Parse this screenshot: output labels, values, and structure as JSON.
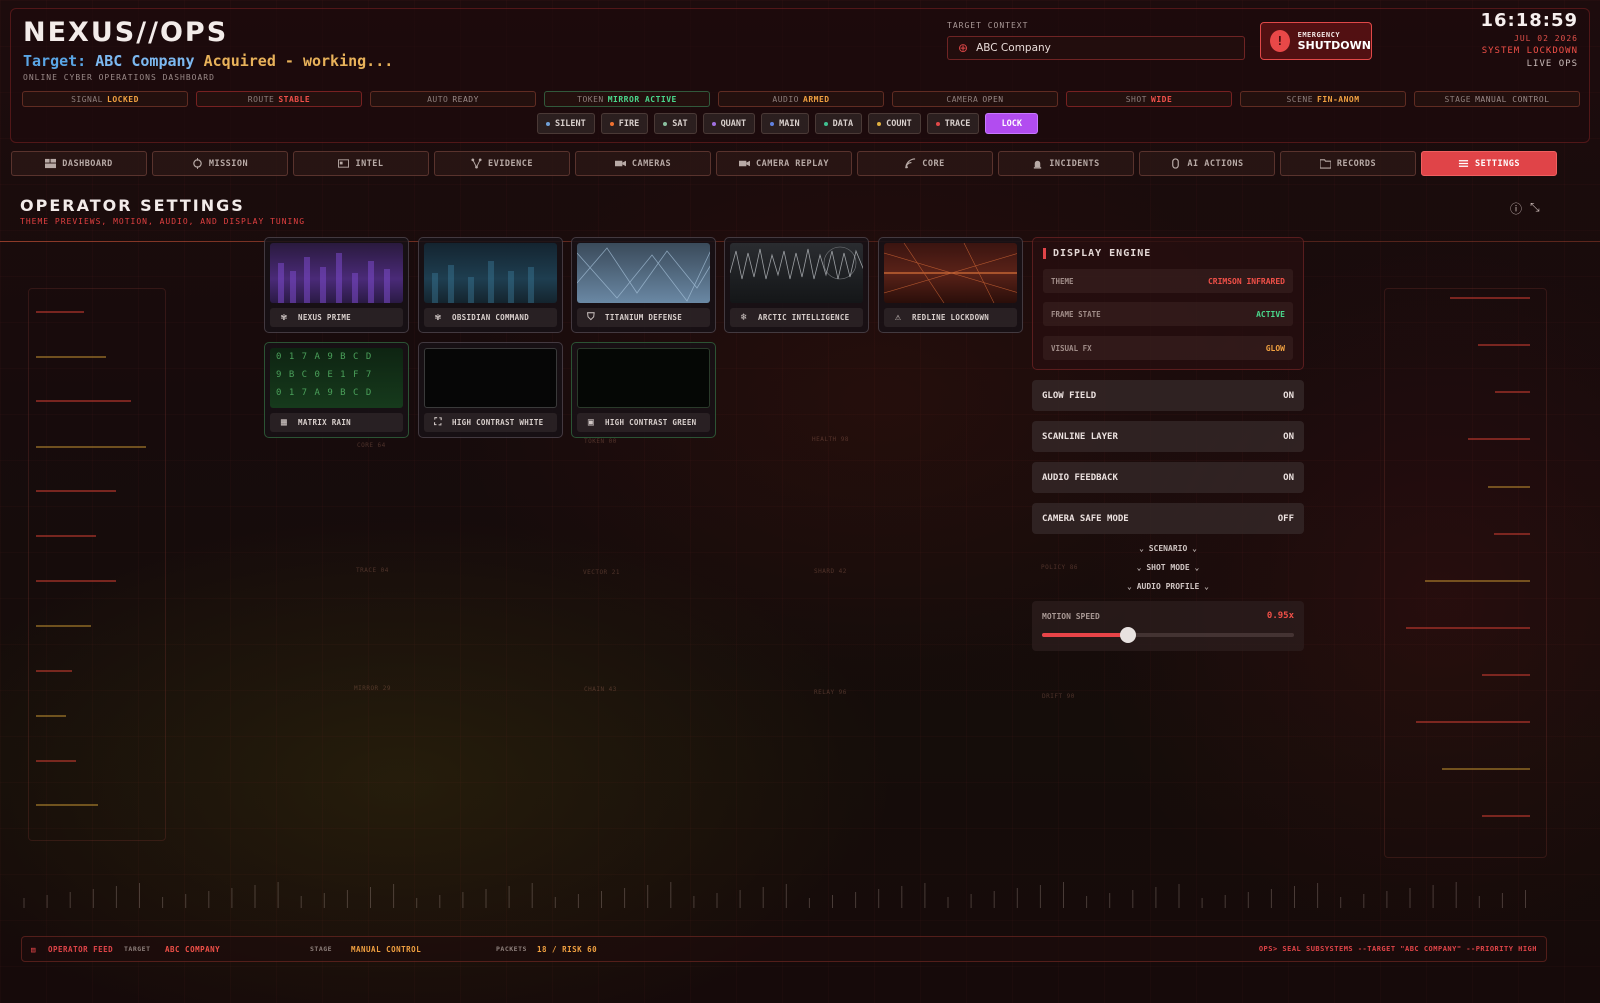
{
  "header": {
    "brand": "NEXUS//OPS",
    "target_prefix": "Target:",
    "target_name": "ABC Company",
    "target_suffix": "Acquired - working...",
    "subtitle": "ONLINE CYBER OPERATIONS DASHBOARD",
    "target_context_label": "TARGET CONTEXT",
    "target_context_value": "ABC Company",
    "emergency_line1": "EMERGENCY",
    "emergency_line2": "SHUTDOWN",
    "time": "16:18:59",
    "date": "JUL 02 2026",
    "lockdown": "SYSTEM LOCKDOWN",
    "live": "LIVE OPS"
  },
  "status_chips": [
    {
      "k": "SIGNAL",
      "v": "LOCKED",
      "tone": "orange"
    },
    {
      "k": "ROUTE",
      "v": "STABLE",
      "tone": "red"
    },
    {
      "k": "AUTO",
      "v": "READY",
      "tone": "mute"
    },
    {
      "k": "TOKEN",
      "v": "MIRROR ACTIVE",
      "tone": "green"
    },
    {
      "k": "AUDIO",
      "v": "ARMED",
      "tone": "orange"
    },
    {
      "k": "CAMERA",
      "v": "OPEN",
      "tone": "mute"
    },
    {
      "k": "SHOT",
      "v": "WIDE",
      "tone": "red"
    },
    {
      "k": "SCENE",
      "v": "FIN-ANOM",
      "tone": "orange"
    },
    {
      "k": "STAGE",
      "v": "MANUAL CONTROL",
      "tone": "mute"
    }
  ],
  "modes": [
    {
      "label": "SILENT",
      "dot": "#6fa0d8"
    },
    {
      "label": "FIRE",
      "dot": "#f07030"
    },
    {
      "label": "SAT",
      "dot": "#8ac0a0"
    },
    {
      "label": "QUANT",
      "dot": "#a070e0"
    },
    {
      "label": "MAIN",
      "dot": "#6080e0"
    },
    {
      "label": "DATA",
      "dot": "#40c090"
    },
    {
      "label": "COUNT",
      "dot": "#e0b040"
    },
    {
      "label": "TRACE",
      "dot": "#e04848"
    },
    {
      "label": "LOCK",
      "dot": ""
    }
  ],
  "nav": [
    {
      "label": "DASHBOARD",
      "icon": "dashboard-icon"
    },
    {
      "label": "MISSION",
      "icon": "crosshair-icon"
    },
    {
      "label": "INTEL",
      "icon": "id-card-icon"
    },
    {
      "label": "EVIDENCE",
      "icon": "network-icon"
    },
    {
      "label": "CAMERAS",
      "icon": "camera-icon"
    },
    {
      "label": "CAMERA REPLAY",
      "icon": "replay-icon"
    },
    {
      "label": "CORE",
      "icon": "signal-icon"
    },
    {
      "label": "INCIDENTS",
      "icon": "alarm-icon"
    },
    {
      "label": "AI ACTIONS",
      "icon": "hand-icon"
    },
    {
      "label": "RECORDS",
      "icon": "folder-icon"
    },
    {
      "label": "SETTINGS",
      "icon": "sliders-icon"
    }
  ],
  "page": {
    "title": "OPERATOR SETTINGS",
    "subtitle": "THEME PREVIEWS, MOTION, AUDIO, AND DISPLAY TUNING"
  },
  "themes": [
    {
      "label": "NEXUS PRIME",
      "icon": "hex-cluster-icon"
    },
    {
      "label": "OBSIDIAN COMMAND",
      "icon": "hex-cluster-icon"
    },
    {
      "label": "TITANIUM DEFENSE",
      "icon": "shield-icon"
    },
    {
      "label": "ARCTIC INTELLIGENCE",
      "icon": "snowflake-icon"
    },
    {
      "label": "REDLINE LOCKDOWN",
      "icon": "warning-icon"
    },
    {
      "label": "MATRIX RAIN",
      "icon": "grid-icon"
    },
    {
      "label": "HIGH CONTRAST WHITE",
      "icon": "focus-icon"
    },
    {
      "label": "HIGH CONTRAST GREEN",
      "icon": "terminal-icon"
    }
  ],
  "matrix_chars": [
    "0 1 7 A 9 B C D",
    "9 B C 0 E 1 F 7",
    "0 1 7 A 9 B C D"
  ],
  "display_engine": {
    "title": "DISPLAY ENGINE",
    "rows": [
      {
        "k": "THEME",
        "v": "CRIMSON INFRARED",
        "color": "#f05048"
      },
      {
        "k": "FRAME STATE",
        "v": "ACTIVE",
        "color": "#4ad88c"
      },
      {
        "k": "VISUAL FX",
        "v": "GLOW",
        "color": "#f0a040"
      }
    ]
  },
  "toggles": [
    {
      "label": "GLOW FIELD",
      "value": "ON"
    },
    {
      "label": "SCANLINE LAYER",
      "value": "ON"
    },
    {
      "label": "AUDIO FEEDBACK",
      "value": "ON"
    },
    {
      "label": "CAMERA SAFE MODE",
      "value": "OFF"
    }
  ],
  "expanders": [
    "SCENARIO",
    "SHOT MODE",
    "AUDIO PROFILE"
  ],
  "motion": {
    "label": "MOTION SPEED",
    "value": "0.95x",
    "fraction": 0.34
  },
  "footer": {
    "feed": "OPERATOR FEED",
    "target_k": "TARGET",
    "target_v": "ABC COMPANY",
    "stage_k": "STAGE",
    "stage_v": "MANUAL CONTROL",
    "packets_k": "PACKETS",
    "packets_v": "18 / RISK 60",
    "command": "OPS> SEAL SUBSYSTEMS --TARGET \"ABC COMPANY\" --PRIORITY HIGH"
  },
  "colors": {
    "accent": "#e04448",
    "lock": "#b24cf0",
    "ok": "#4ad88c",
    "warn": "#f0a040"
  }
}
